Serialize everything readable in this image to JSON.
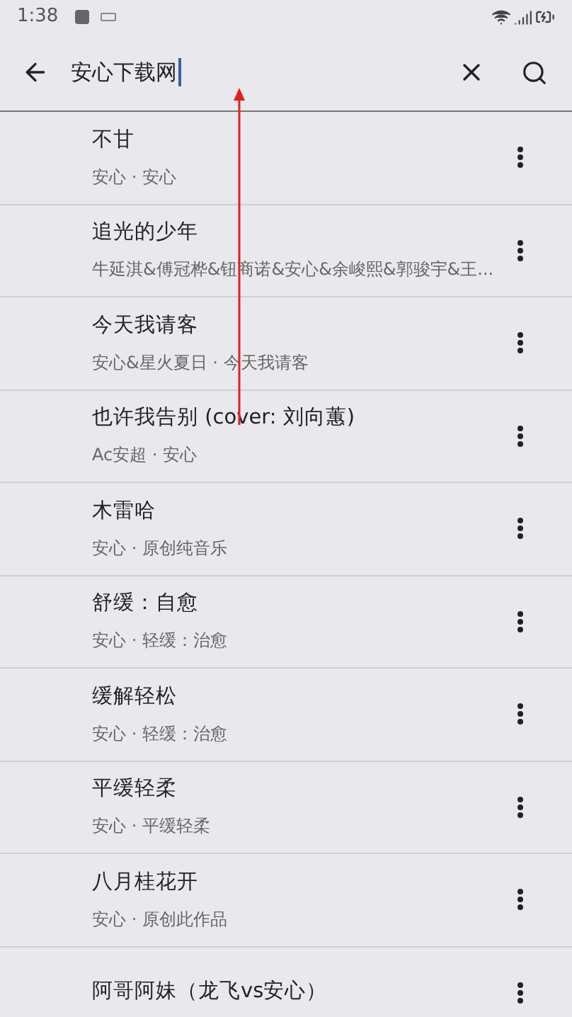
{
  "status_bar": {
    "time": "1:38"
  },
  "search": {
    "value": "安心下载网"
  },
  "results": [
    {
      "title": "不甘",
      "subtitle": "安心 · 安心"
    },
    {
      "title": "追光的少年",
      "subtitle": "牛延淇&傅冠桦&钮商诺&安心&余峻熙&郭骏宇&王..."
    },
    {
      "title": "今天我请客",
      "subtitle": "安心&星火夏日 · 今天我请客"
    },
    {
      "title": "也许我告别 (cover: 刘向蕙)",
      "subtitle": "Ac安超 · 安心"
    },
    {
      "title": "木雷哈",
      "subtitle": "安心 · 原创纯音乐"
    },
    {
      "title": "舒缓：自愈",
      "subtitle": "安心 · 轻缓：治愈"
    },
    {
      "title": "缓解轻松",
      "subtitle": "安心 · 轻缓：治愈"
    },
    {
      "title": "平缓轻柔",
      "subtitle": "安心 · 平缓轻柔"
    },
    {
      "title": "八月桂花开",
      "subtitle": "安心 · 原创此作品"
    },
    {
      "title": "阿哥阿妹（龙飞vs安心）"
    }
  ]
}
